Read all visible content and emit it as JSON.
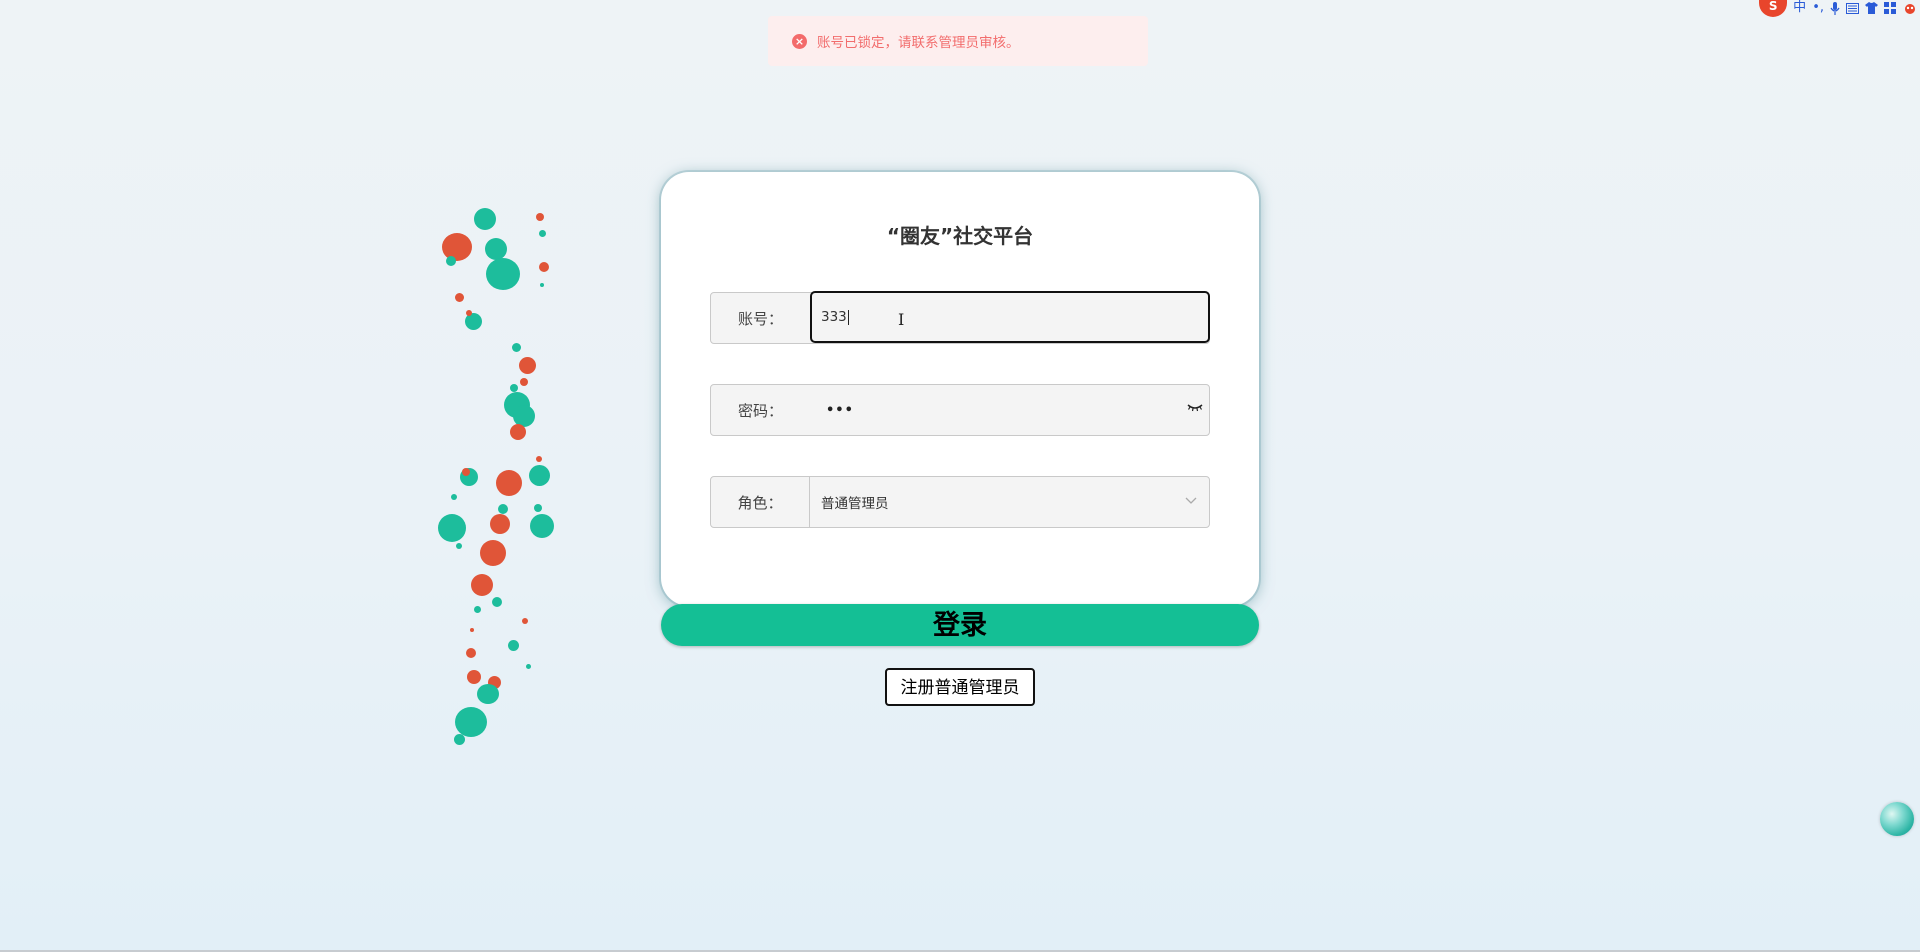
{
  "toast": {
    "icon": "error-circle-icon",
    "message": "账号已锁定，请联系管理员审核。",
    "color": "#f26d6d"
  },
  "ime": {
    "logo": "S",
    "items": [
      "中",
      "•,",
      "mic-icon",
      "keyboard-icon",
      "shirt-icon",
      "grid-icon",
      "skin-icon"
    ]
  },
  "login": {
    "title": "“圈友”社交平台",
    "account_label": "账号：",
    "account_value": "333",
    "password_label": "密码：",
    "password_mask": "•••",
    "role_label": "角色：",
    "role_value": "普通管理员",
    "login_button": "登录",
    "register_button": "注册普通管理员",
    "accent_color": "#14bf95"
  }
}
